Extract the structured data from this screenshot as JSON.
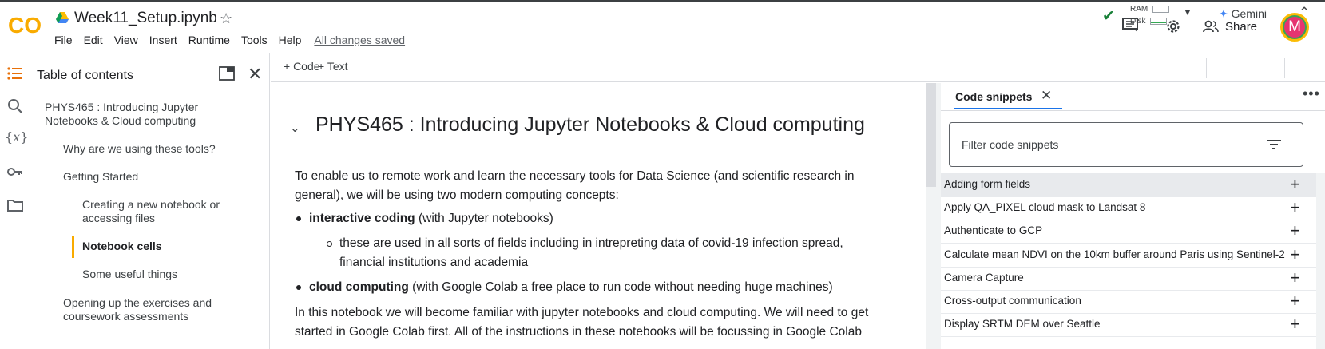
{
  "app": {
    "logo_text": "CO",
    "notebook_title": "Week11_Setup.ipynb",
    "menu": [
      "File",
      "Edit",
      "View",
      "Insert",
      "Runtime",
      "Tools",
      "Help"
    ],
    "save_status": "All changes saved",
    "share_label": "Share",
    "avatar_letter": "M"
  },
  "toolbar": {
    "add_code": "+ Code",
    "add_text": "+ Text",
    "ram_label": "RAM",
    "disk_label": "Disk",
    "gemini_label": "Gemini"
  },
  "toc": {
    "title": "Table of contents",
    "items": [
      {
        "label": "PHYS465 : Introducing Jupyter",
        "label2": "Notebooks & Cloud computing"
      },
      {
        "label": "Why are we using these tools?"
      },
      {
        "label": "Getting Started"
      },
      {
        "label": "Creating a new notebook or",
        "label2": "accessing files"
      },
      {
        "label": "Notebook cells"
      },
      {
        "label": "Some useful things"
      },
      {
        "label": "Opening up the exercises and",
        "label2": "coursework assessments"
      }
    ]
  },
  "notebook": {
    "heading": "PHYS465 : Introducing Jupyter Notebooks & Cloud computing",
    "intro_line1": "To enable us to remote work and learn the necessary tools for Data Science (and scientific research in",
    "intro_line2": "general), we will be using two modern computing concepts:",
    "bullet1_bold": "interactive coding",
    "bullet1_rest": " (with Jupyter notebooks)",
    "sub1_line1": "these are used in all sorts of fields including in intrepreting data of covid-19 infection spread,",
    "sub1_line2": "financial institutions and academia",
    "bullet2_bold": "cloud computing",
    "bullet2_rest": " (with Google Colab a free place to run code without needing huge machines)",
    "outro_line1": "In this notebook we will become familiar with jupyter notebooks and cloud computing. We will need to get",
    "outro_line2": "started in Google Colab first. All of the instructions in these notebooks will be focussing in Google Colab"
  },
  "snippets": {
    "tab_label": "Code snippets",
    "filter_placeholder": "Filter code snippets",
    "items": [
      "Adding form fields",
      "Apply QA_PIXEL cloud mask to Landsat 8",
      "Authenticate to GCP",
      "Calculate mean NDVI on the 10km buffer around Paris using Sentinel-2",
      "Camera Capture",
      "Cross-output communication",
      "Display SRTM DEM over Seattle"
    ],
    "add_symbol": "+"
  },
  "colors": {
    "accent_blue": "#1a73e8",
    "logo_orange": "#f9ab00",
    "avatar_bg": "#e53470",
    "ok_green": "#188038"
  }
}
